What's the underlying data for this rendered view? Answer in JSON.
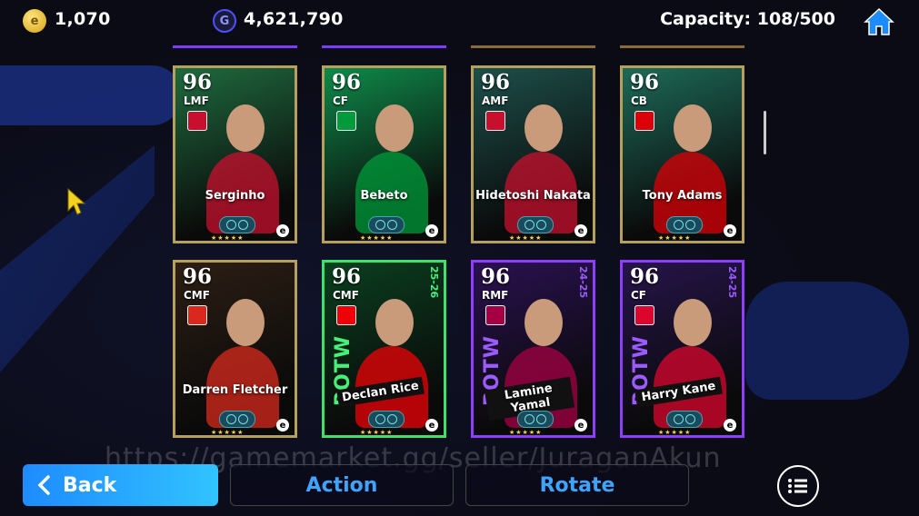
{
  "topbar": {
    "coins": "1,070",
    "gp": "4,621,790",
    "capacity": "Capacity: 108/500",
    "gold_icon_letter": "e",
    "gp_icon_letter": "G"
  },
  "cards": [
    {
      "rating": "96",
      "position": "LMF",
      "name": "Serginho",
      "type": "gold",
      "art": "#1f6a3e",
      "badge": "#c8102e"
    },
    {
      "rating": "96",
      "position": "CF",
      "name": "Bebeto",
      "type": "gold",
      "art": "#0f8a4a",
      "badge": "#009b3a"
    },
    {
      "rating": "96",
      "position": "AMF",
      "name": "Hidetoshi Nakata",
      "type": "gold",
      "art": "#1d4f4a",
      "badge": "#c8102e"
    },
    {
      "rating": "96",
      "position": "CB",
      "name": "Tony Adams",
      "type": "gold",
      "art": "#1d6a58",
      "badge": "#db0007"
    },
    {
      "rating": "96",
      "position": "CMF",
      "name": "Darren Fletcher",
      "type": "gold",
      "art": "#2c1e14",
      "badge": "#da291c"
    },
    {
      "rating": "96",
      "position": "CMF",
      "name": "Declan Rice",
      "type": "potw-green",
      "art": "#0a3f1f",
      "badge": "#ef0107",
      "potw": "POTW",
      "season": "25-26"
    },
    {
      "rating": "96",
      "position": "RMF",
      "name": "Lamine Yamal",
      "type": "potw-purple",
      "art": "#2a1150",
      "badge": "#a50044",
      "potw": "POTW",
      "season": "24-25"
    },
    {
      "rating": "96",
      "position": "CF",
      "name": "Harry Kane",
      "type": "potw-purple",
      "art": "#26144a",
      "badge": "#dc052d",
      "potw": "POTW",
      "season": "24-25"
    }
  ],
  "watermark": "https://gamemarket.gg/seller/JuraganAkun",
  "buttons": {
    "back": "Back",
    "action": "Action",
    "rotate": "Rotate"
  },
  "efootball_mark": "e",
  "stars": "★★★★★"
}
